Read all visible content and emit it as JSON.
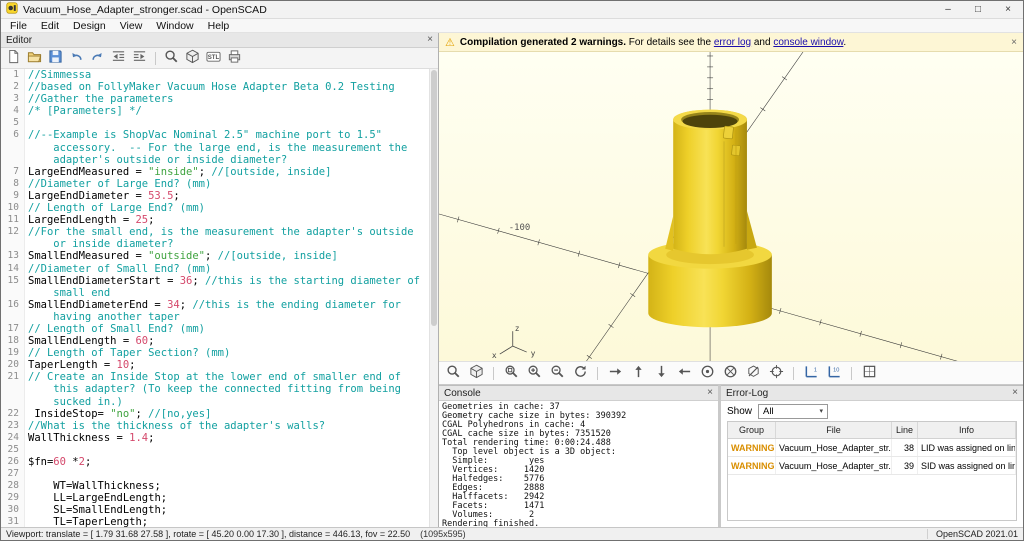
{
  "titlebar": {
    "title": "Vacuum_Hose_Adapter_stronger.scad - OpenSCAD"
  },
  "glyphs": {
    "close": "×",
    "minimize": "–",
    "maximize": "□",
    "warning": "⚠",
    "dropdown": "▾"
  },
  "menubar": {
    "items": [
      "File",
      "Edit",
      "Design",
      "View",
      "Window",
      "Help"
    ]
  },
  "editor": {
    "header": "Editor",
    "toolbar": [
      {
        "name": "new-file-button",
        "icon": "new-file-icon"
      },
      {
        "name": "open-file-button",
        "icon": "open-folder-icon"
      },
      {
        "name": "save-button",
        "icon": "save-icon"
      },
      {
        "name": "undo-button",
        "icon": "undo-icon"
      },
      {
        "name": "redo-button",
        "icon": "redo-icon"
      },
      {
        "name": "unindent-button",
        "icon": "unindent-icon"
      },
      {
        "name": "indent-button",
        "icon": "indent-icon"
      },
      {
        "sep": true
      },
      {
        "name": "preview-button",
        "icon": "preview-icon"
      },
      {
        "name": "render-button",
        "icon": "render-icon"
      },
      {
        "name": "export-stl-button",
        "icon": "export-stl-icon"
      },
      {
        "name": "send-to-printer-button",
        "icon": "send-to-printer-icon"
      }
    ],
    "lines": [
      {
        "n": 1,
        "s": [
          [
            "com",
            "//Simmessa"
          ]
        ]
      },
      {
        "n": 2,
        "s": [
          [
            "com",
            "//based on FollyMaker Vacuum Hose Adapter Beta 0.2 Testing"
          ]
        ]
      },
      {
        "n": 3,
        "s": [
          [
            "com",
            "//Gather the parameters"
          ]
        ]
      },
      {
        "n": 4,
        "s": [
          [
            "com",
            "/* [Parameters] */"
          ]
        ]
      },
      {
        "n": 5,
        "s": []
      },
      {
        "n": 6,
        "s": [
          [
            "com",
            "//--Example is ShopVac Nominal 2.5\" machine port to 1.5\" accessory.  -- For the large end, is the measurement the adapter's outside or inside diameter?"
          ]
        ]
      },
      {
        "n": 7,
        "s": [
          [
            "pln",
            "LargeEndMeasured = "
          ],
          [
            "str",
            "\"inside\""
          ],
          [
            "pln",
            "; "
          ],
          [
            "com",
            "//[outside, inside]"
          ]
        ]
      },
      {
        "n": 8,
        "s": [
          [
            "com",
            "//Diameter of Large End? (mm)"
          ]
        ]
      },
      {
        "n": 9,
        "s": [
          [
            "pln",
            "LargeEndDiameter = "
          ],
          [
            "num",
            "53.5"
          ],
          [
            "pln",
            ";"
          ]
        ]
      },
      {
        "n": 10,
        "s": [
          [
            "com",
            "// Length of Large End? (mm)"
          ]
        ]
      },
      {
        "n": 11,
        "s": [
          [
            "pln",
            "LargeEndLength = "
          ],
          [
            "num",
            "25"
          ],
          [
            "pln",
            ";"
          ]
        ]
      },
      {
        "n": 12,
        "s": [
          [
            "com",
            "//For the small end, is the measurement the adapter's outside or inside diameter?"
          ]
        ]
      },
      {
        "n": 13,
        "s": [
          [
            "pln",
            "SmallEndMeasured = "
          ],
          [
            "str",
            "\"outside\""
          ],
          [
            "pln",
            "; "
          ],
          [
            "com",
            "//[outside, inside]"
          ]
        ]
      },
      {
        "n": 14,
        "s": [
          [
            "com",
            "//Diameter of Small End? (mm)"
          ]
        ]
      },
      {
        "n": 15,
        "s": [
          [
            "pln",
            "SmallEndDiameterStart = "
          ],
          [
            "num",
            "36"
          ],
          [
            "pln",
            "; "
          ],
          [
            "com",
            "//this is the starting diameter of small end"
          ]
        ]
      },
      {
        "n": 16,
        "s": [
          [
            "pln",
            "SmallEndDiameterEnd = "
          ],
          [
            "num",
            "34"
          ],
          [
            "pln",
            "; "
          ],
          [
            "com",
            "//this is the ending diameter for having another taper"
          ]
        ]
      },
      {
        "n": 17,
        "s": [
          [
            "com",
            "// Length of Small End? (mm)"
          ]
        ]
      },
      {
        "n": 18,
        "s": [
          [
            "pln",
            "SmallEndLength = "
          ],
          [
            "num",
            "60"
          ],
          [
            "pln",
            ";"
          ]
        ]
      },
      {
        "n": 19,
        "s": [
          [
            "com",
            "// Length of Taper Section? (mm)"
          ]
        ]
      },
      {
        "n": 20,
        "s": [
          [
            "pln",
            "TaperLength = "
          ],
          [
            "num",
            "10"
          ],
          [
            "pln",
            ";"
          ]
        ]
      },
      {
        "n": 21,
        "s": [
          [
            "com",
            "// Create an Inside Stop at the lower end of smaller end of this adapter? (To keep the connected fitting from being sucked in.)"
          ]
        ]
      },
      {
        "n": 22,
        "s": [
          [
            "pln",
            " InsideStop= "
          ],
          [
            "str",
            "\"no\""
          ],
          [
            "pln",
            "; "
          ],
          [
            "com",
            "//[no,yes]"
          ]
        ]
      },
      {
        "n": 23,
        "s": [
          [
            "com",
            "//What is the thickness of the adapter's walls?"
          ]
        ]
      },
      {
        "n": 24,
        "s": [
          [
            "pln",
            "WallThickness = "
          ],
          [
            "num",
            "1.4"
          ],
          [
            "pln",
            ";"
          ]
        ]
      },
      {
        "n": 25,
        "s": []
      },
      {
        "n": 26,
        "s": [
          [
            "pln",
            "$fn="
          ],
          [
            "num",
            "60"
          ],
          [
            "pln",
            " *"
          ],
          [
            "num",
            "2"
          ],
          [
            "pln",
            ";"
          ]
        ]
      },
      {
        "n": 27,
        "s": []
      },
      {
        "n": 28,
        "s": [
          [
            "pln",
            "    WT=WallThickness;"
          ]
        ]
      },
      {
        "n": 29,
        "s": [
          [
            "pln",
            "    LL=LargeEndLength;"
          ]
        ]
      },
      {
        "n": 30,
        "s": [
          [
            "pln",
            "    SL=SmallEndLength;"
          ]
        ]
      },
      {
        "n": 31,
        "s": [
          [
            "pln",
            "    TL=TaperLength;"
          ]
        ]
      }
    ]
  },
  "banner": {
    "bold": "Compilation generated 2 warnings.",
    "text1": " For details see the ",
    "link1": "error log",
    "text2": " and ",
    "link2": "console window",
    "text3": "."
  },
  "viewport": {
    "axis_label": "-100",
    "triad": [
      "z",
      "x",
      "y"
    ],
    "toolbar": [
      {
        "name": "preview-button",
        "icon": "preview-icon"
      },
      {
        "name": "render-button",
        "icon": "render-icon"
      },
      {
        "sep": true
      },
      {
        "name": "zoom-all-button",
        "icon": "zoom-all-icon"
      },
      {
        "name": "zoom-in-button",
        "icon": "zoom-in-icon"
      },
      {
        "name": "zoom-out-button",
        "icon": "zoom-out-icon"
      },
      {
        "name": "reset-view-button",
        "icon": "reset-view-icon"
      },
      {
        "sep": true
      },
      {
        "name": "view-right-button",
        "icon": "arrow-right-icon"
      },
      {
        "name": "view-top-button",
        "icon": "arrow-up-icon"
      },
      {
        "name": "view-bottom-button",
        "icon": "arrow-down-icon"
      },
      {
        "name": "view-left-button",
        "icon": "arrow-left-icon"
      },
      {
        "name": "view-front-button",
        "icon": "circle-dot-icon"
      },
      {
        "name": "view-back-button",
        "icon": "circle-cross-icon"
      },
      {
        "name": "view-diagonal-button",
        "icon": "cube-diagonal-icon"
      },
      {
        "name": "view-center-button",
        "icon": "crosshair-icon"
      },
      {
        "sep": true
      },
      {
        "name": "show-axes-button",
        "icon": "axes-icon"
      },
      {
        "name": "show-scale-markers-button",
        "icon": "scale-markers-icon"
      },
      {
        "sep": true
      },
      {
        "name": "orthogonal-view-button",
        "icon": "frame-icon"
      }
    ]
  },
  "console": {
    "title": "Console",
    "lines": [
      "Geometries in cache: 37",
      "Geometry cache size in bytes: 390392",
      "CGAL Polyhedrons in cache: 4",
      "CGAL cache size in bytes: 7351520",
      "Total rendering time: 0:00:24.488",
      "  Top level object is a 3D object:",
      "  Simple:        yes",
      "  Vertices:     1420",
      "  Halfedges:    5776",
      "  Edges:        2888",
      "  Halffacets:   2942",
      "  Facets:       1471",
      "  Volumes:       2",
      "Rendering finished."
    ]
  },
  "error_log": {
    "title": "Error-Log",
    "show_label": "Show",
    "filter_value": "All",
    "columns": [
      "Group",
      "File",
      "Line",
      "Info"
    ],
    "rows": [
      {
        "group": "WARNING",
        "file": "Vacuum_Hose_Adapter_str...",
        "line": "38",
        "info": "LID was assigned on line ..."
      },
      {
        "group": "WARNING",
        "file": "Vacuum_Hose_Adapter_str...",
        "line": "39",
        "info": "SID was assigned on line ..."
      }
    ]
  },
  "statusbar": {
    "left": "Viewport: translate = [ 1.79 31.68 27.58 ], rotate = [ 45.20 0.00 17.30 ], distance = 446.13, fov = 22.50",
    "size": "(1095x595)",
    "right": "OpenSCAD 2021.01"
  },
  "colors": {
    "model_yellow": "#f0d231",
    "viewport_background": "#fffbe0",
    "comment": "#12a0a0",
    "string": "#3fa33f",
    "number": "#d4486b",
    "warning_status": "#d98e00",
    "link": "#1a0dab",
    "toolbar_icon_blue": "#3465a4"
  }
}
